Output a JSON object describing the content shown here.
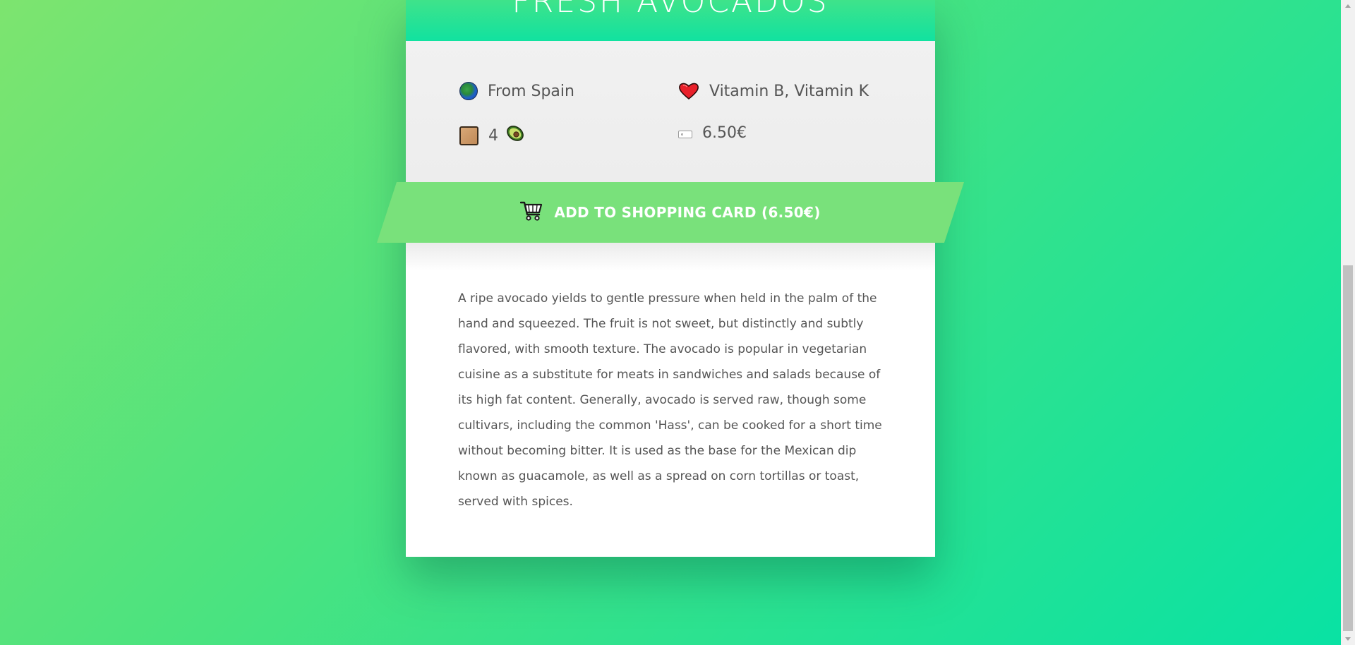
{
  "product": {
    "title": "FRESH AVOCADOS",
    "origin": "From Spain",
    "vitamins": "Vitamin B, Vitamin K",
    "quantity": "4",
    "price": "6.50€"
  },
  "cart_button": {
    "label": "ADD TO SHOPPING CARD (6.50€)"
  },
  "description": "A ripe avocado yields to gentle pressure when held in the palm of the hand and squeezed. The fruit is not sweet, but distinctly and subtly flavored, with smooth texture. The avocado is popular in vegetarian cuisine as a substitute for meats in sandwiches and salads because of its high fat content. Generally, avocado is served raw, though some cultivars, including the common 'Hass', can be cooked for a short time without becoming bitter. It is used as the base for the Mexican dip known as guacamole, as well as a spread on corn tortillas or toast, served with spices.",
  "icons": {
    "origin": "globe-icon",
    "vitamins": "heart-icon",
    "quantity": "box-icon",
    "quantity_unit": "avocado-icon",
    "price": "price-tag-icon",
    "cart": "shopping-cart-icon"
  },
  "colors": {
    "background_start": "#7de46f",
    "background_end": "#08e2a4",
    "header": "#11e2a0",
    "button": "#79e17b",
    "text": "#555555"
  }
}
